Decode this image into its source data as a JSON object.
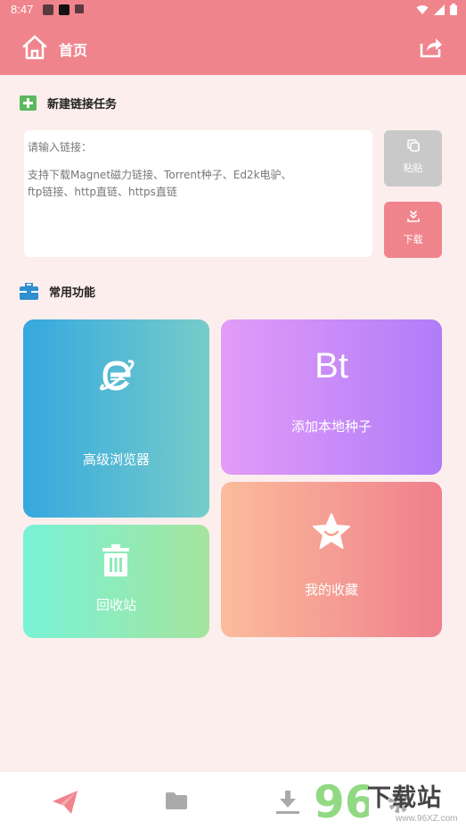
{
  "status_bar": {
    "time": "8:47"
  },
  "app_bar": {
    "title": "首页"
  },
  "new_task": {
    "title": "新建链接任务",
    "input_label": "请输入链接：",
    "input_hint_line1": "支持下载Magnet磁力链接、Torrent种子、Ed2k电驴、",
    "input_hint_line2": "ftp链接、http直链、https直链",
    "paste_label": "粘贴",
    "download_label": "下载"
  },
  "functions": {
    "title": "常用功能",
    "browser_label": "高级浏览器",
    "bt_text": "Bt",
    "bt_label": "添加本地种子",
    "recycle_label": "回收站",
    "favorites_label": "我的收藏"
  },
  "watermark": {
    "text": "下载站",
    "url": "www.96XZ.com",
    "digits": "96"
  },
  "icons": {
    "home": "home-icon",
    "share": "share-icon",
    "add": "add-icon",
    "toolbox": "toolbox-icon",
    "paste": "paste-icon",
    "download": "download-icon",
    "browser": "ie-browser-icon",
    "trash": "trash-icon",
    "star": "star-icon",
    "nav_send": "send-icon",
    "nav_folder": "folder-icon",
    "nav_download": "download-tray-icon",
    "nav_settings": "gear-icon"
  },
  "colors": {
    "accent": "#f0848d",
    "background": "#fdeeee",
    "section_add": "#5cb85c",
    "section_toolbox": "#2f8fd0"
  }
}
